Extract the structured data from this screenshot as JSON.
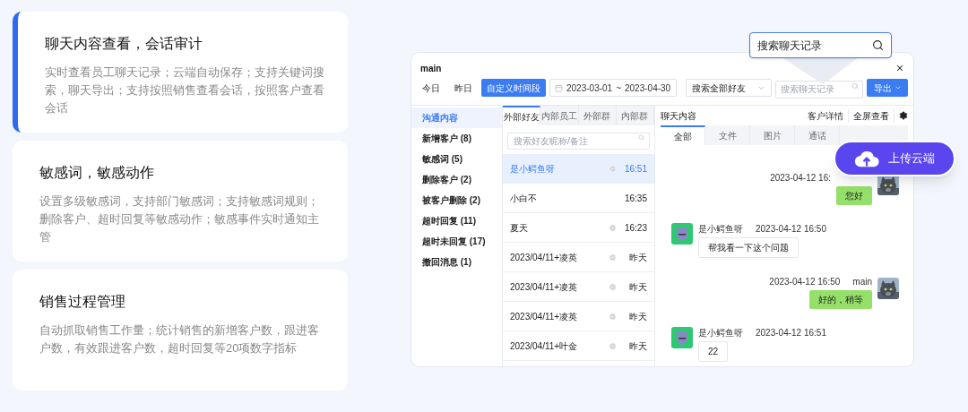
{
  "features": [
    {
      "title": "聊天内容查看，会话审计",
      "description": "实时查看员工聊天记录；云端自动保存；支持关键词搜索，聊天导出；支持按照销售查看会话，按照客户查看会话",
      "selected": true
    },
    {
      "title": "敏感词，敏感动作",
      "description": "设置多级敏感词，支持部门敏感词；支持敏感词规则；删除客户、超时回复等敏感动作；敏感事件实时通知主管",
      "selected": false
    },
    {
      "title": "销售过程管理",
      "description": "自动抓取销售工作量；统计销售的新增客户数，跟进客户数，有效跟进客户数，超时回复等20项数字指标",
      "selected": false
    }
  ],
  "search_callout": {
    "value": "搜索聊天记录"
  },
  "window": {
    "title": "main"
  },
  "toolbar": {
    "quick_ranges": [
      {
        "label": "今日",
        "selected": false
      },
      {
        "label": "昨日",
        "selected": false
      },
      {
        "label": "自定义时间段",
        "selected": true
      }
    ],
    "date_range": {
      "start": "2023-03-01",
      "separator": "~",
      "end": "2023-04-30"
    },
    "friend_select": {
      "value": "搜索全部好友"
    },
    "search": {
      "placeholder": "搜索聊天记录"
    },
    "export_button": "导出"
  },
  "nav": [
    {
      "label": "沟通内容",
      "selected": true
    },
    {
      "label": "新增客户 (8)",
      "selected": false
    },
    {
      "label": "敏感词 (5)",
      "selected": false
    },
    {
      "label": "删除客户 (2)",
      "selected": false
    },
    {
      "label": "被客户删除 (2)",
      "selected": false
    },
    {
      "label": "超时回复 (11)",
      "selected": false
    },
    {
      "label": "超时未回复 (17)",
      "selected": false
    },
    {
      "label": "撤回消息 (1)",
      "selected": false
    }
  ],
  "list_tabs": [
    {
      "label": "外部好友",
      "selected": true
    },
    {
      "label": "内部员工",
      "selected": false
    },
    {
      "label": "外部群",
      "selected": false
    },
    {
      "label": "内部群",
      "selected": false
    }
  ],
  "list_search": {
    "placeholder": "搜索好友昵称/备注"
  },
  "conversations": [
    {
      "name": "是小鳄鱼呀",
      "time": "16:51",
      "selected": true,
      "checked": true
    },
    {
      "name": "小白不",
      "time": "16:35",
      "selected": false,
      "checked": false
    },
    {
      "name": "夏天",
      "time": "16:23",
      "selected": false,
      "checked": true
    },
    {
      "name": "2023/04/11+凌英",
      "time": "昨天",
      "selected": false,
      "checked": true
    },
    {
      "name": "2023/04/11+凌英",
      "time": "昨天",
      "selected": false,
      "checked": true
    },
    {
      "name": "2023/04/11+凌英",
      "time": "昨天",
      "selected": false,
      "checked": true
    },
    {
      "name": "2023/04/11+叶金",
      "time": "昨天",
      "selected": false,
      "checked": true
    }
  ],
  "chat": {
    "title": "聊天内容",
    "actions": [
      "客户详情",
      "全屏查看"
    ],
    "tabs": [
      {
        "label": "全部",
        "selected": true
      },
      {
        "label": "文件",
        "selected": false
      },
      {
        "label": "图片",
        "selected": false
      },
      {
        "label": "通话",
        "selected": false
      }
    ],
    "messages": [
      {
        "kind": "outgoing",
        "time": "2023-04-12 16:",
        "text": "您好"
      },
      {
        "kind": "incoming",
        "sender": "是小鳄鱼呀",
        "time": "2023-04-12 16:50",
        "text": "帮我看一下这个问题"
      },
      {
        "kind": "outgoing",
        "sender": "main",
        "time": "2023-04-12 16:50",
        "text": "好的，稍等"
      },
      {
        "kind": "incoming",
        "sender": "是小鳄鱼呀",
        "time": "2023-04-12 16:51",
        "text": "22"
      }
    ]
  },
  "upload_button": "上传云端"
}
